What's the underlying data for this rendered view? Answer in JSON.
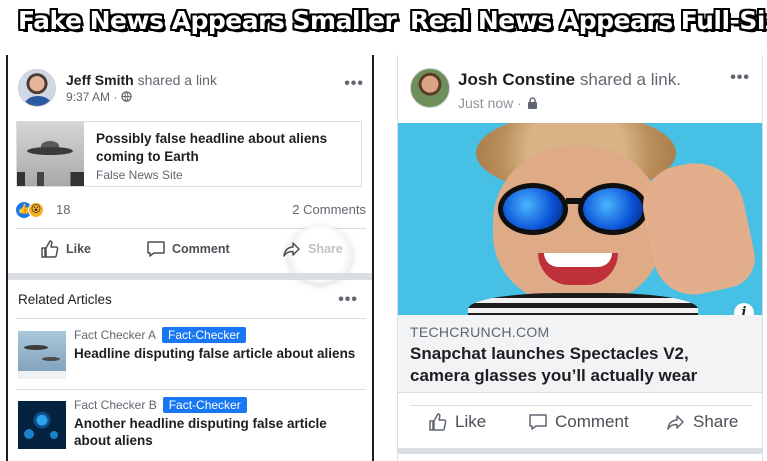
{
  "banners": {
    "left": "Fake News Appears Smaller",
    "right": "Real News Appears Full-Size"
  },
  "left_post": {
    "author": "Jeff Smith",
    "shared_text": "shared a link",
    "time": "9:37 AM · ",
    "link": {
      "title": "Possibly false headline about aliens coming to Earth",
      "source": "False News Site"
    },
    "reaction_count": "18",
    "comments": "2 Comments",
    "actions": {
      "like": "Like",
      "comment": "Comment",
      "share": "Share"
    },
    "menu_dots": "•••"
  },
  "related": {
    "header": "Related Articles",
    "menu_dots": "•••",
    "items": [
      {
        "publisher": "Fact Checker A",
        "badge": "Fact-Checker",
        "title": "Headline disputing false article about aliens"
      },
      {
        "publisher": "Fact Checker B",
        "badge": "Fact-Checker",
        "title": "Another headline disputing false article about aliens"
      }
    ]
  },
  "right_post": {
    "author": "Josh Constine",
    "shared_text": "shared a link.",
    "time": "Just now · ",
    "menu_dots": "•••",
    "link": {
      "domain": "TECHCRUNCH.COM",
      "title": "Snapchat launches Spectacles V2, camera glasses you’ll actually wear"
    },
    "info_badge": "i",
    "actions": {
      "like": "Like",
      "comment": "Comment",
      "share": "Share"
    }
  },
  "colors": {
    "facebook_blue": "#1877f2",
    "wow_yellow": "#f7b125",
    "text_primary": "#1c1e21",
    "text_secondary": "#606770"
  },
  "icons": [
    "globe-icon",
    "lock-icon",
    "like-icon",
    "comment-icon",
    "share-icon",
    "info-icon",
    "more-dots-icon"
  ]
}
